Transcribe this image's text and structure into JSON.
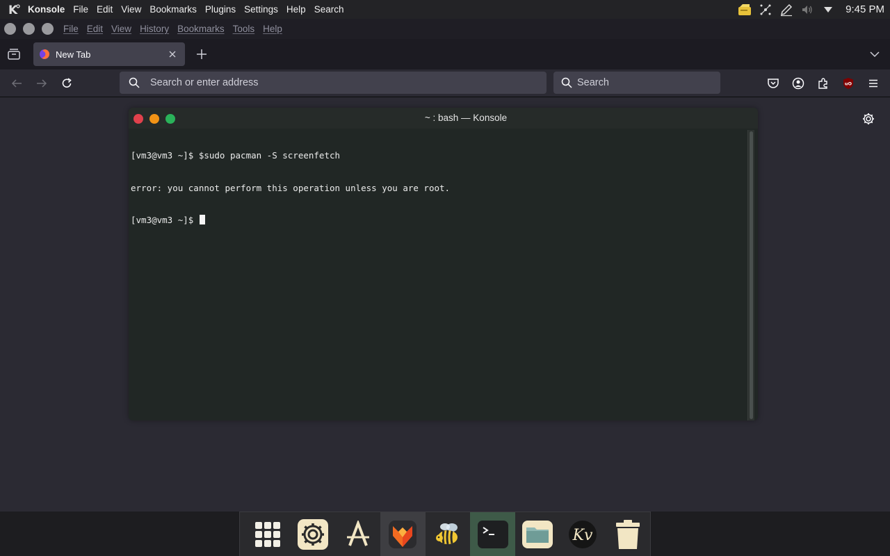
{
  "system_panel": {
    "app_name": "Konsole",
    "menu": [
      "File",
      "Edit",
      "View",
      "Bookmarks",
      "Plugins",
      "Settings",
      "Help",
      "Search"
    ],
    "clock": "9:45 PM"
  },
  "firefox": {
    "menu": [
      "File",
      "Edit",
      "View",
      "History",
      "Bookmarks",
      "Tools",
      "Help"
    ],
    "tab": {
      "title": "New Tab"
    },
    "urlbar": {
      "placeholder": "Search or enter address"
    },
    "searchbar": {
      "placeholder": "Search"
    }
  },
  "konsole": {
    "title": "~ : bash — Konsole",
    "lines": [
      "[vm3@vm3 ~]$ $sudo pacman -S screenfetch",
      "error: you cannot perform this operation unless you are root.",
      "[vm3@vm3 ~]$ "
    ]
  },
  "dock": {
    "items": [
      "app-grid-icon",
      "settings-icon",
      "app-store-icon",
      "firefox-icon",
      "bee-icon",
      "terminal-icon",
      "files-icon",
      "kv-icon",
      "trash-icon"
    ]
  },
  "colors": {
    "accent_term": "#3e5a48",
    "traffic_red": "#e0414c",
    "traffic_orange": "#f29316",
    "traffic_green": "#2ab25a"
  }
}
